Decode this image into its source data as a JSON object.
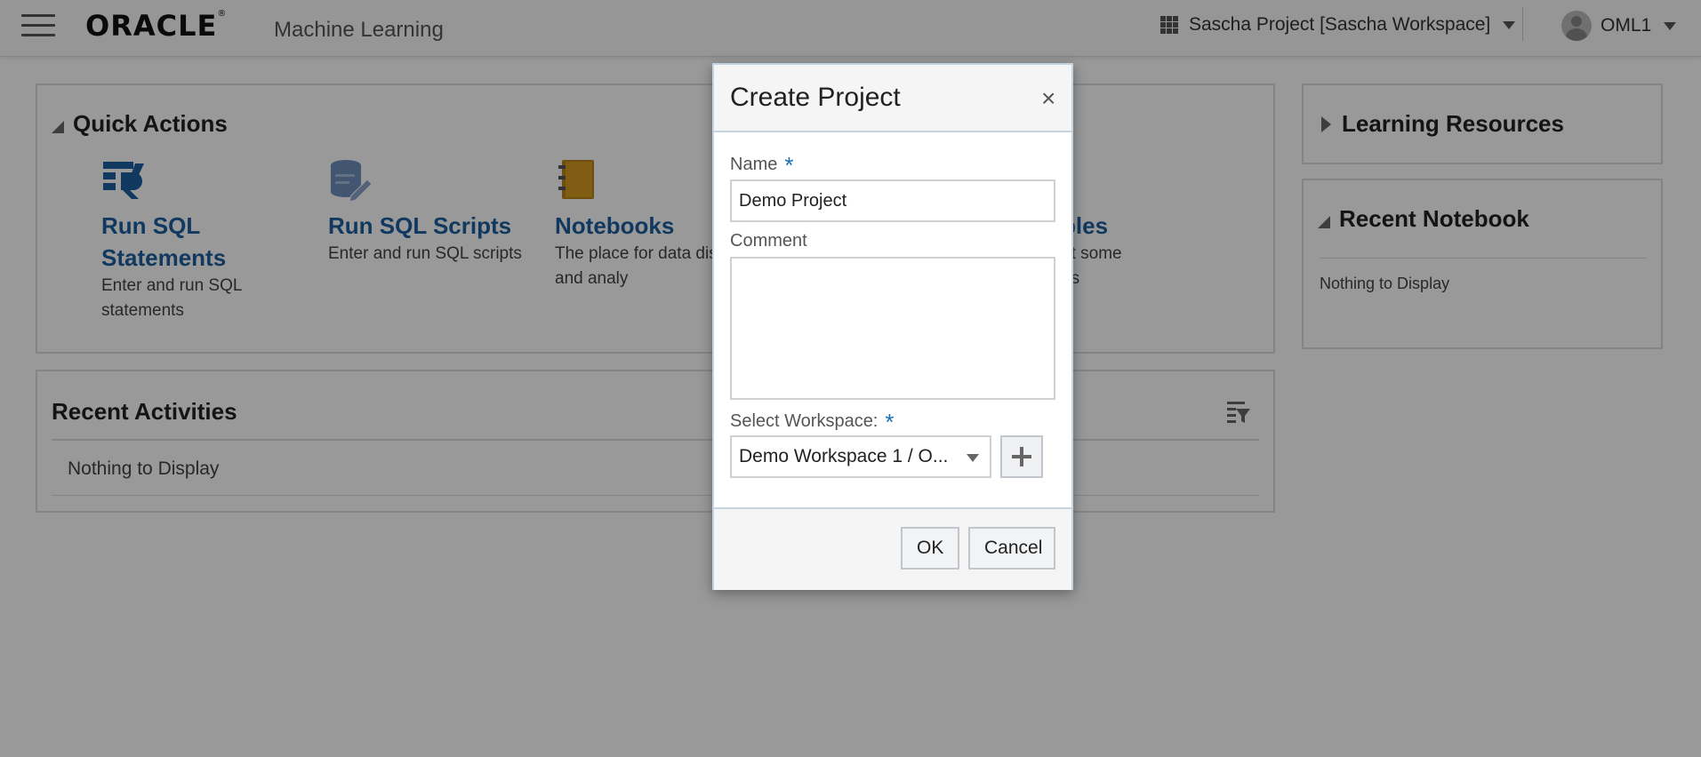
{
  "header": {
    "logo_text": "ORACLE",
    "logo_reg": "®",
    "product": "Machine Learning",
    "project_selector": "Sascha Project [Sascha Workspace]",
    "user": "OML1"
  },
  "quick_actions": {
    "title": "Quick Actions",
    "items": [
      {
        "title": "Run SQL Statements",
        "desc": "Enter and run SQL statements",
        "icon": "run-sql-icon",
        "color": "#1d5fa1"
      },
      {
        "title": "Run SQL Scripts",
        "desc": "Enter and run SQL scripts",
        "icon": "sql-scripts-icon",
        "color": "#6f8fbf"
      },
      {
        "title": "Notebooks",
        "desc": "The place for data discovery and analy",
        "icon": "notebook-icon",
        "color": "#d69c1e"
      },
      {
        "title": "ples",
        "desc": "ut some es",
        "desc_line1": "ut some",
        "desc_line2": "es"
      }
    ]
  },
  "recent_activities": {
    "title": "Recent Activities",
    "empty": "Nothing to Display"
  },
  "learning_resources": {
    "title": "Learning Resources"
  },
  "recent_notebook": {
    "title": "Recent Notebook",
    "empty": "Nothing to Display"
  },
  "dialog": {
    "title": "Create Project",
    "close": "×",
    "name_label": "Name",
    "name_value": "Demo Project",
    "required_mark": "*",
    "comment_label": "Comment",
    "comment_value": "",
    "workspace_label": "Select Workspace:",
    "workspace_value": "Demo Workspace 1 / O...",
    "ok_label": "OK",
    "cancel_label": "Cancel"
  }
}
